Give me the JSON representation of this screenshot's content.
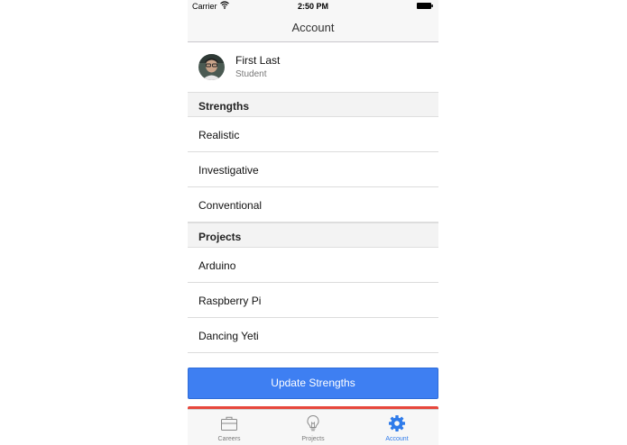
{
  "status_bar": {
    "carrier": "Carrier",
    "time": "2:50 PM"
  },
  "nav": {
    "title": "Account"
  },
  "profile": {
    "name": "First Last",
    "role": "Student"
  },
  "sections": {
    "strengths": {
      "header": "Strengths",
      "items": [
        "Realistic",
        "Investigative",
        "Conventional"
      ]
    },
    "projects": {
      "header": "Projects",
      "items": [
        "Arduino",
        "Raspberry Pi",
        "Dancing Yeti"
      ]
    }
  },
  "buttons": {
    "update_label": "Update Strengths"
  },
  "tabs": [
    {
      "label": "Careers",
      "icon": "briefcase-icon"
    },
    {
      "label": "Projects",
      "icon": "lightbulb-icon"
    },
    {
      "label": "Account",
      "icon": "gear-icon",
      "active": true
    }
  ],
  "colors": {
    "accent": "#3e7ff2",
    "danger": "#e7473c",
    "tab_active": "#2f7bea"
  }
}
